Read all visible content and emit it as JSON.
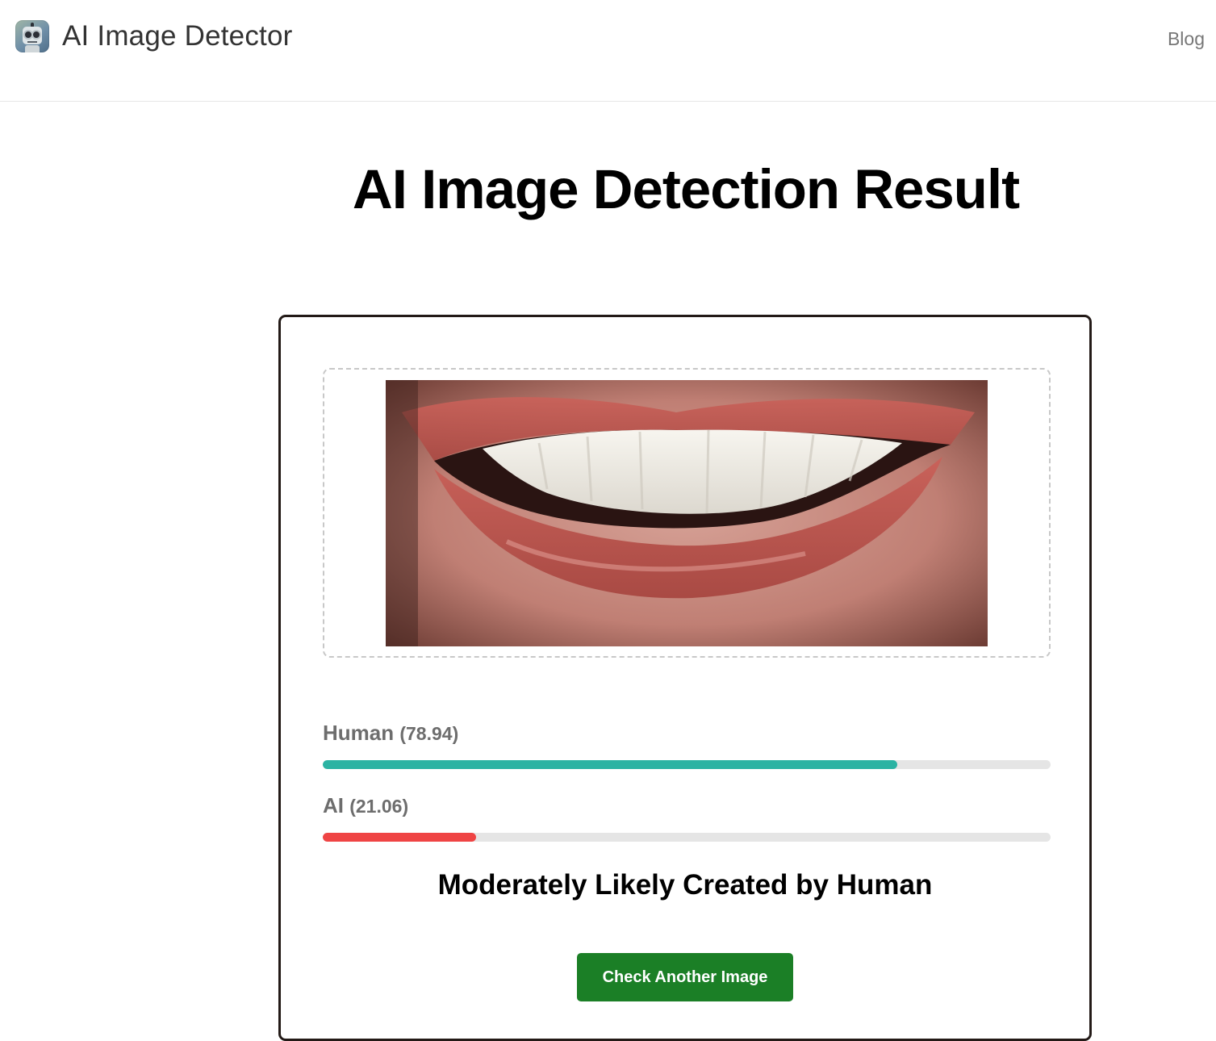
{
  "header": {
    "brand_name": "AI Image Detector",
    "logo_icon": "robot-icon",
    "nav": {
      "blog_label": "Blog"
    }
  },
  "page": {
    "title": "AI Image Detection Result"
  },
  "result": {
    "uploaded_image_alt": "",
    "scores": [
      {
        "label": "Human",
        "value_text": "(78.94)",
        "value": 78.94,
        "color": "#2bb3a3"
      },
      {
        "label": "AI",
        "value_text": "(21.06)",
        "value": 21.06,
        "color": "#ef4444"
      }
    ],
    "verdict": "Moderately Likely Created by Human",
    "check_another_label": "Check Another Image"
  },
  "colors": {
    "primary_button": "#1b7f26",
    "card_border": "#231a17",
    "track": "#e5e5e5"
  }
}
